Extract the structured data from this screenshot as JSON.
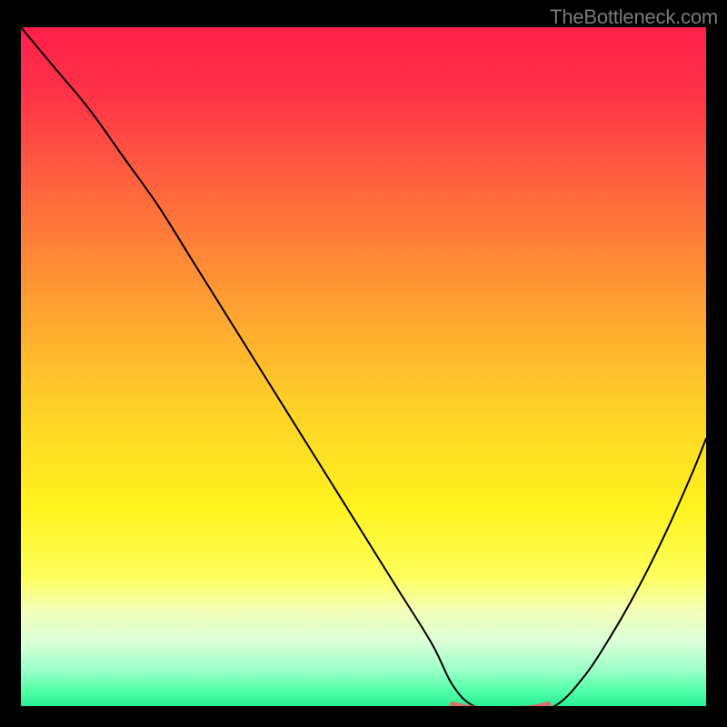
{
  "attribution": "TheBottleneck.com",
  "chart_data": {
    "type": "line",
    "title": "",
    "xlabel": "",
    "ylabel": "",
    "xlim": [
      0,
      100
    ],
    "ylim": [
      0,
      100
    ],
    "grid": false,
    "legend": false,
    "annotations": [],
    "series": [
      {
        "name": "bottleneck-curve",
        "color": "#000000",
        "x": [
          0,
          5,
          10,
          15,
          20,
          25,
          30,
          35,
          40,
          45,
          50,
          55,
          60,
          63,
          66,
          70,
          74,
          78,
          82,
          86,
          90,
          94,
          98,
          100
        ],
        "y": [
          100,
          94,
          88,
          81,
          74,
          66,
          58,
          50,
          42,
          34,
          26,
          18,
          10,
          4,
          1,
          0.5,
          0.5,
          1,
          5,
          11,
          18,
          26,
          35,
          40
        ]
      },
      {
        "name": "minimum-marker",
        "color": "#d6706a",
        "x": [
          63,
          66,
          70,
          74,
          77
        ],
        "y": [
          1.2,
          0.6,
          0.5,
          0.6,
          1.2
        ]
      }
    ],
    "gradient_stops": [
      {
        "pct": 0,
        "color": "#ff1f4a"
      },
      {
        "pct": 10,
        "color": "#ff3347"
      },
      {
        "pct": 25,
        "color": "#ff6a3d"
      },
      {
        "pct": 40,
        "color": "#ff9e32"
      },
      {
        "pct": 55,
        "color": "#ffcf28"
      },
      {
        "pct": 70,
        "color": "#fff31e"
      },
      {
        "pct": 80,
        "color": "#fdff5a"
      },
      {
        "pct": 85,
        "color": "#f3ffb6"
      },
      {
        "pct": 90,
        "color": "#d8ffd8"
      },
      {
        "pct": 94,
        "color": "#96ffc5"
      },
      {
        "pct": 97,
        "color": "#4fffa8"
      },
      {
        "pct": 100,
        "color": "#17e98a"
      }
    ]
  }
}
